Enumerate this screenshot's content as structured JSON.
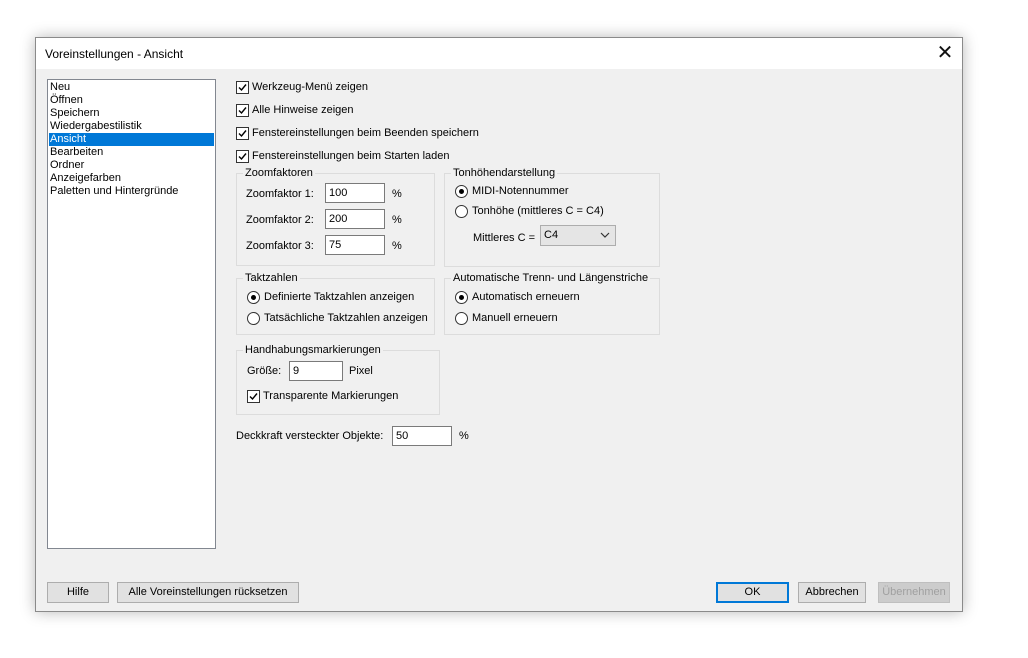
{
  "window": {
    "title": "Voreinstellungen - Ansicht"
  },
  "categories": [
    "Neu",
    "Öffnen",
    "Speichern",
    "Wiedergabestilistik",
    "Ansicht",
    "Bearbeiten",
    "Ordner",
    "Anzeigefarben",
    "Paletten und Hintergründe"
  ],
  "selected_category": "Ansicht",
  "checkboxes": {
    "toolbox_menu": {
      "label": "Werkzeug-Menü zeigen",
      "checked": true
    },
    "all_hints": {
      "label": "Alle Hinweise zeigen",
      "checked": true
    },
    "save_on_exit": {
      "label": "Fenstereinstellungen beim Beenden speichern",
      "checked": true
    },
    "load_on_start": {
      "label": "Fenstereinstellungen beim Starten laden",
      "checked": true
    }
  },
  "zoom": {
    "legend": "Zoomfaktoren",
    "rows": [
      {
        "label": "Zoomfaktor 1:",
        "value": "100",
        "unit": "%"
      },
      {
        "label": "Zoomfaktor 2:",
        "value": "200",
        "unit": "%"
      },
      {
        "label": "Zoomfaktor 3:",
        "value": "75",
        "unit": "%"
      }
    ]
  },
  "pitch": {
    "legend": "Tonhöhendarstellung",
    "midi_label": "MIDI-Notennummer",
    "pitch_label": "Tonhöhe (mittleres C = C4)",
    "selected": "midi",
    "middle_c_label": "Mittleres C =",
    "middle_c_value": "C4"
  },
  "measures": {
    "legend": "Taktzahlen",
    "defined_label": "Definierte Taktzahlen anzeigen",
    "actual_label": "Tatsächliche Taktzahlen anzeigen",
    "selected": "defined"
  },
  "barlines": {
    "legend": "Automatische Trenn- und Längenstriche",
    "auto_label": "Automatisch erneuern",
    "manual_label": "Manuell erneuern",
    "selected": "auto"
  },
  "handles": {
    "legend": "Handhabungsmarkierungen",
    "size_label": "Größe:",
    "size_value": "9",
    "size_unit": "Pixel",
    "transparent_label": "Transparente Markierungen",
    "transparent_checked": true
  },
  "opacity": {
    "label": "Deckkraft versteckter Objekte:",
    "value": "50",
    "unit": "%"
  },
  "buttons": {
    "help": "Hilfe",
    "reset_all": "Alle Voreinstellungen rücksetzen",
    "ok": "OK",
    "cancel": "Abbrechen",
    "apply": "Übernehmen"
  },
  "colors": {
    "selection": "#0078d7",
    "dialog_bg": "#f0f0f0"
  }
}
